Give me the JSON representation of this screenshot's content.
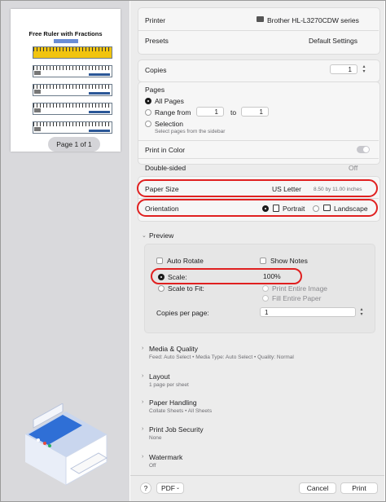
{
  "preview": {
    "thumbnail_title": "Free Ruler with Fractions",
    "page_indicator": "Page 1 of 1"
  },
  "printer": {
    "label": "Printer",
    "value": "Brother HL-L3270CDW series"
  },
  "presets": {
    "label": "Presets",
    "value": "Default Settings"
  },
  "copies": {
    "label": "Copies",
    "value": "1"
  },
  "pages": {
    "label": "Pages",
    "all_pages": "All Pages",
    "range_from": "Range from",
    "from_value": "1",
    "to_label": "to",
    "to_value": "1",
    "selection": "Selection",
    "selection_hint": "Select pages from the sidebar"
  },
  "print_in_color": {
    "label": "Print in Color"
  },
  "double_sided": {
    "label": "Double-sided",
    "value": "Off"
  },
  "paper_size": {
    "label": "Paper Size",
    "value": "US Letter",
    "detail": "8.50 by 11.00 inches"
  },
  "orientation": {
    "label": "Orientation",
    "portrait": "Portrait",
    "landscape": "Landscape"
  },
  "preview_section": {
    "title": "Preview",
    "auto_rotate": "Auto Rotate",
    "show_notes": "Show Notes",
    "scale": "Scale:",
    "scale_value": "100%",
    "scale_to_fit": "Scale to Fit:",
    "print_entire_image": "Print Entire Image",
    "fill_entire_paper": "Fill Entire Paper",
    "copies_per_page_label": "Copies per page:",
    "copies_per_page_value": "1"
  },
  "sections": [
    {
      "title": "Media & Quality",
      "summary": "Feed: Auto Select • Media Type: Auto Select • Quality: Normal"
    },
    {
      "title": "Layout",
      "summary": "1 page per sheet"
    },
    {
      "title": "Paper Handling",
      "summary": "Collate Sheets • All Sheets"
    },
    {
      "title": "Print Job Security",
      "summary": "None"
    },
    {
      "title": "Watermark",
      "summary": "Off"
    }
  ],
  "footer": {
    "help": "?",
    "pdf": "PDF",
    "cancel": "Cancel",
    "print": "Print"
  },
  "colors": {
    "highlight": "#e02020",
    "panel": "#ececec",
    "sidebar": "#d9d9dc"
  }
}
